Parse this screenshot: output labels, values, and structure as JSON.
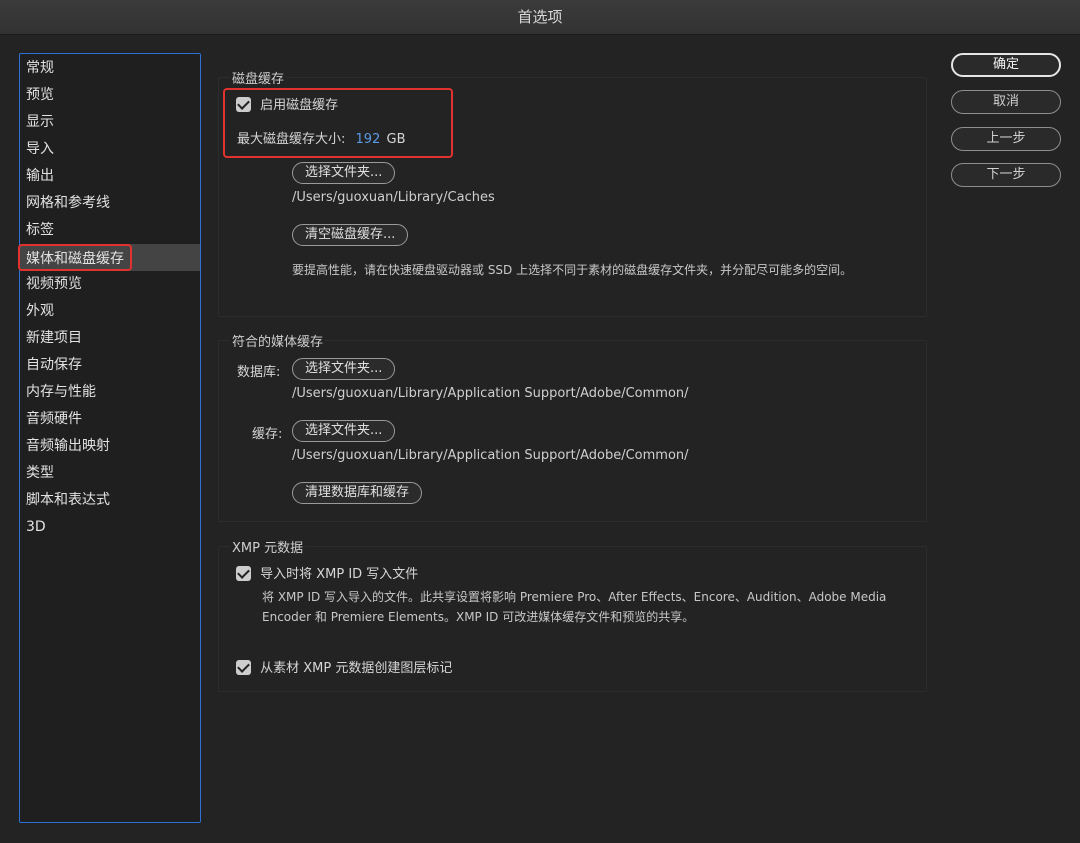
{
  "window": {
    "title": "首选项"
  },
  "sidebar": {
    "items": [
      {
        "label": "常规"
      },
      {
        "label": "预览"
      },
      {
        "label": "显示"
      },
      {
        "label": "导入"
      },
      {
        "label": "输出"
      },
      {
        "label": "网格和参考线"
      },
      {
        "label": "标签"
      },
      {
        "label": "媒体和磁盘缓存",
        "selected": true
      },
      {
        "label": "视频预览"
      },
      {
        "label": "外观"
      },
      {
        "label": "新建项目"
      },
      {
        "label": "自动保存"
      },
      {
        "label": "内存与性能"
      },
      {
        "label": "音频硬件"
      },
      {
        "label": "音频输出映射"
      },
      {
        "label": "类型"
      },
      {
        "label": "脚本和表达式"
      },
      {
        "label": "3D"
      }
    ]
  },
  "disk_cache": {
    "title": "磁盘缓存",
    "enable_label": "启用磁盘缓存",
    "enable_checked": true,
    "max_size_label": "最大磁盘缓存大小:",
    "max_size_value": "192",
    "max_size_unit": "GB",
    "choose_folder": "选择文件夹...",
    "path": "/Users/guoxuan/Library/Caches",
    "clear_button": "清空磁盘缓存...",
    "note": "要提高性能，请在快速硬盘驱动器或 SSD 上选择不同于素材的磁盘缓存文件夹，并分配尽可能多的空间。"
  },
  "media_cache": {
    "title": "符合的媒体缓存",
    "database_label": "数据库:",
    "database_button": "选择文件夹...",
    "database_path": "/Users/guoxuan/Library/Application Support/Adobe/Common/",
    "cache_label": "缓存:",
    "cache_button": "选择文件夹...",
    "cache_path": "/Users/guoxuan/Library/Application Support/Adobe/Common/",
    "clean_button": "清理数据库和缓存"
  },
  "xmp": {
    "title": "XMP 元数据",
    "write_id_label": "导入时将 XMP ID 写入文件",
    "write_id_checked": true,
    "write_id_note": "将 XMP ID 写入导入的文件。此共享设置将影响 Premiere Pro、After Effects、Encore、Audition、Adobe Media Encoder 和 Premiere Elements。XMP ID 可改进媒体缓存文件和预览的共享。",
    "markers_label": "从素材 XMP 元数据创建图层标记",
    "markers_checked": true
  },
  "buttons": {
    "ok": "确定",
    "cancel": "取消",
    "prev": "上一步",
    "next": "下一步"
  },
  "colors": {
    "highlight": "#e0322e",
    "accent": "#2f6fd6",
    "value": "#5a9be6"
  }
}
